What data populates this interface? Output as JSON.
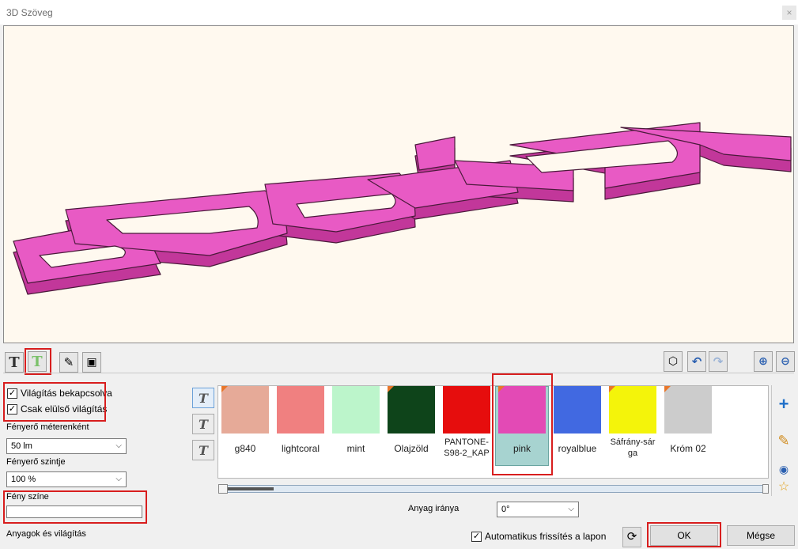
{
  "window": {
    "title": "3D Szöveg",
    "close_label": "×"
  },
  "colors": {
    "text_pink": "#e34ab5",
    "background": "#fff9ef"
  },
  "preview": {
    "text": "design"
  },
  "lighting": {
    "enabled_label": "Világítás bekapcsolva",
    "front_only_label": "Csak elülső világítás",
    "brightness_per_meter_label": "Fényerő méterenként",
    "brightness_per_meter_value": "50 lm",
    "brightness_level_label": "Fényerő szintje",
    "brightness_level_value": "100 %",
    "light_color_label": "Fény színe"
  },
  "materials": [
    {
      "name": "g840",
      "color": "#e6aa98",
      "corner": true
    },
    {
      "name": "lightcoral",
      "color": "#f08080",
      "corner": false
    },
    {
      "name": "mint",
      "color": "#bcf5cb",
      "corner": false
    },
    {
      "name": "Olajzöld",
      "color": "#0e441a",
      "corner": true
    },
    {
      "name": "PANTONE-S98-2_KAP",
      "color": "#e60d0d",
      "corner": false
    },
    {
      "name": "pink",
      "color": "#e34ab5",
      "corner": true,
      "selected": true
    },
    {
      "name": "royalblue",
      "color": "#4169e1",
      "corner": false
    },
    {
      "name": "Sáfrány-sárga",
      "color": "#f4f40a",
      "corner": true
    },
    {
      "name": "Króm 02",
      "color": "#cccccc",
      "corner": true
    }
  ],
  "material_direction": {
    "label": "Anyag iránya",
    "value": "0°"
  },
  "footer": {
    "section_label": "Anyagok és világítás",
    "auto_refresh_label": "Automatikus frissítés a lapon",
    "ok_label": "OK",
    "cancel_label": "Mégse"
  }
}
